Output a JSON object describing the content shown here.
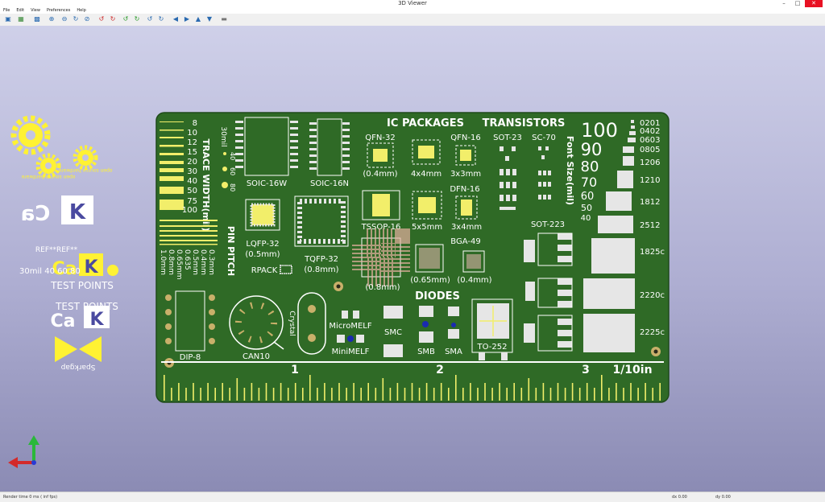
{
  "window": {
    "title": "3D Viewer",
    "minimize": "–",
    "maximize": "□",
    "close": "✕"
  },
  "menu": {
    "file": "File",
    "edit": "Edit",
    "view": "View",
    "preferences": "Preferences",
    "help": "Help"
  },
  "toolbar": {
    "icons": [
      "reload-icon",
      "copy-icon",
      "render-icon",
      "zoom-in-icon",
      "zoom-out-icon",
      "zoom-redraw-icon",
      "zoom-fit-icon",
      "rotate-x-ccw-icon",
      "rotate-x-cw-icon",
      "rotate-y-ccw-icon",
      "rotate-y-cw-icon",
      "rotate-z-ccw-icon",
      "rotate-z-cw-icon",
      "pan-left-icon",
      "pan-right-icon",
      "pan-up-icon",
      "pan-down-icon",
      "ortho-icon"
    ],
    "glyphs": [
      "▣",
      "▦",
      "▩",
      "⊕",
      "⊖",
      "↻",
      "⊘",
      "↺",
      "↻",
      "↺",
      "↻",
      "↺",
      "↻",
      "◀",
      "▶",
      "▲",
      "▼",
      "▬"
    ]
  },
  "status": {
    "render_time": "Render time 0 ms ( inf fps)",
    "dx": "dx 0.00",
    "dy": "dy 0.00"
  },
  "board": {
    "colors": {
      "pcb": "#2f6a26",
      "silk": "#ffffff",
      "copper": "#f2ee6a",
      "pad": "#e6e6e6"
    },
    "labels": {
      "trace_width": "TRACE WIDTH(mil)",
      "pin_pitch": "PIN PITCH",
      "trace_values": [
        "8",
        "10",
        "12",
        "15",
        "20",
        "30",
        "40",
        "50",
        "75",
        "100"
      ],
      "mil_row": "30mil",
      "mil_values": [
        "40",
        "60",
        "80"
      ],
      "pitch_values": [
        "1.0mm",
        "0.8mm",
        "0.65mm",
        "0.635",
        "0.5mm",
        "0.4mm",
        "0.3mm"
      ],
      "ic_packages": "IC PACKAGES",
      "transistors": "TRANSISTORS",
      "diodes": "DIODES",
      "font_size": "Font Size(mil)",
      "font_values": [
        "100",
        "90",
        "80",
        "70",
        "60",
        "50",
        "40"
      ],
      "passives": [
        "0201",
        "0402",
        "0603",
        "0805",
        "1206",
        "1210",
        "1812",
        "2512",
        "1825c",
        "2220c",
        "2225c"
      ],
      "soic16w": "SOIC-16W",
      "soic16n": "SOIC-16N",
      "qfn32": "QFN-32",
      "qfn32_pitch": "(0.4mm)",
      "qfn_4x4": "4x4mm",
      "qfn16": "QFN-16",
      "qfn16_size": "3x3mm",
      "sot23": "SOT-23",
      "sc70": "SC-70",
      "lqfp32": "LQFP-32",
      "lqfp32_pitch": "(0.5mm)",
      "tqfp32": "TQFP-32",
      "tqfp32_pitch": "(0.8mm)",
      "tssop16": "TSSOP-16",
      "size_5x5": "5x5mm",
      "dfn16": "DFN-16",
      "dfn16_size": "3x4mm",
      "bga49": "BGA-49",
      "bga_pitch_1": "(0.8mm)",
      "bga_pitch_2": "(0.65mm)",
      "bga_pitch_3": "(0.4mm)",
      "sot223": "SOT-223",
      "rpack": "RPACK",
      "dip8": "DIP-8",
      "can10": "CAN10",
      "crystal": "Crystal",
      "micromelf": "MicroMELF",
      "minimelf": "MiniMELF",
      "smc": "SMC",
      "smb": "SMB",
      "sma": "SMA",
      "to252": "TO-252",
      "ruler_1": "1",
      "ruler_2": "2",
      "ruler_3": "3",
      "ruler_unit": "1/10in"
    },
    "offboard": {
      "osh_text": "open source hardware",
      "kicad_text": "KiCad",
      "ref_text": "REF**REF**",
      "test_points_1": "TEST POINTS",
      "test_points_2": "TEST POINTS",
      "mil_overlay": "30mil 40 60 80",
      "sparkgap_text": "Sparkgap"
    }
  }
}
